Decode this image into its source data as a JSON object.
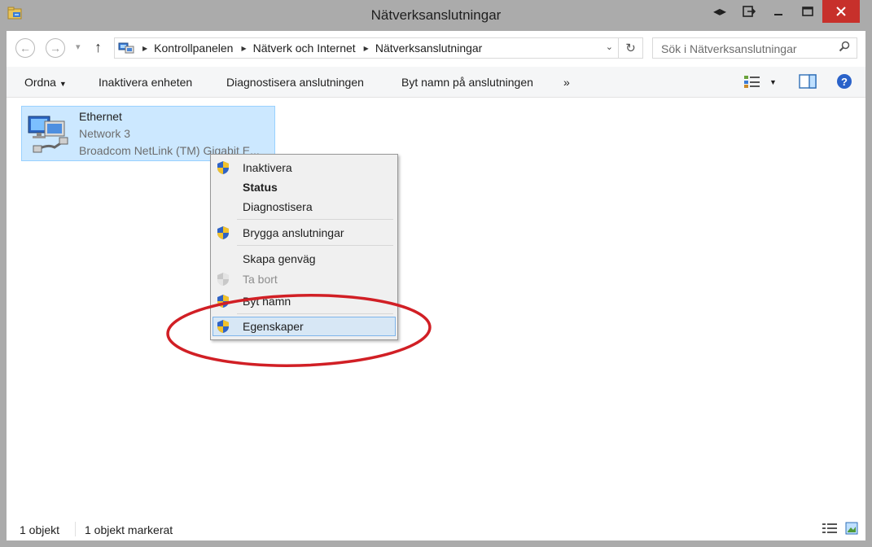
{
  "window": {
    "title": "Nätverksanslutningar",
    "icons": [
      "folder-network-icon",
      "snap-icon",
      "restore-icon",
      "minimize-icon",
      "maximize-icon",
      "close-icon"
    ]
  },
  "address": {
    "crumbs": [
      "Kontrollpanelen",
      "Nätverk och Internet",
      "Nätverksanslutningar"
    ],
    "search_placeholder": "Sök i Nätverksanslutningar"
  },
  "toolbar": {
    "organize": "Ordna",
    "disable_device": "Inaktivera enheten",
    "diagnose": "Diagnostisera anslutningen",
    "rename": "Byt namn på anslutningen",
    "more": "»"
  },
  "connection": {
    "name": "Ethernet",
    "network": "Network  3",
    "adapter": "Broadcom NetLink (TM) Gigabit E..."
  },
  "context_menu": {
    "items": [
      {
        "label": "Inaktivera",
        "shield": true
      },
      {
        "label": "Status",
        "bold": true
      },
      {
        "label": "Diagnostisera"
      },
      {
        "label": "Brygga anslutningar",
        "shield": true
      },
      {
        "label": "Skapa genväg"
      },
      {
        "label": "Ta bort",
        "shield": true,
        "disabled": true
      },
      {
        "label": "Byt namn",
        "shield": true
      },
      {
        "label": "Egenskaper",
        "shield": true,
        "highlighted": true
      }
    ]
  },
  "status": {
    "count": "1 objekt",
    "selected": "1 objekt markerat"
  },
  "colors": {
    "selection": "#cce8ff",
    "menu_highlight": "#d7e7f5",
    "annotation_red": "#d11f25",
    "close_button": "#c7302b"
  }
}
